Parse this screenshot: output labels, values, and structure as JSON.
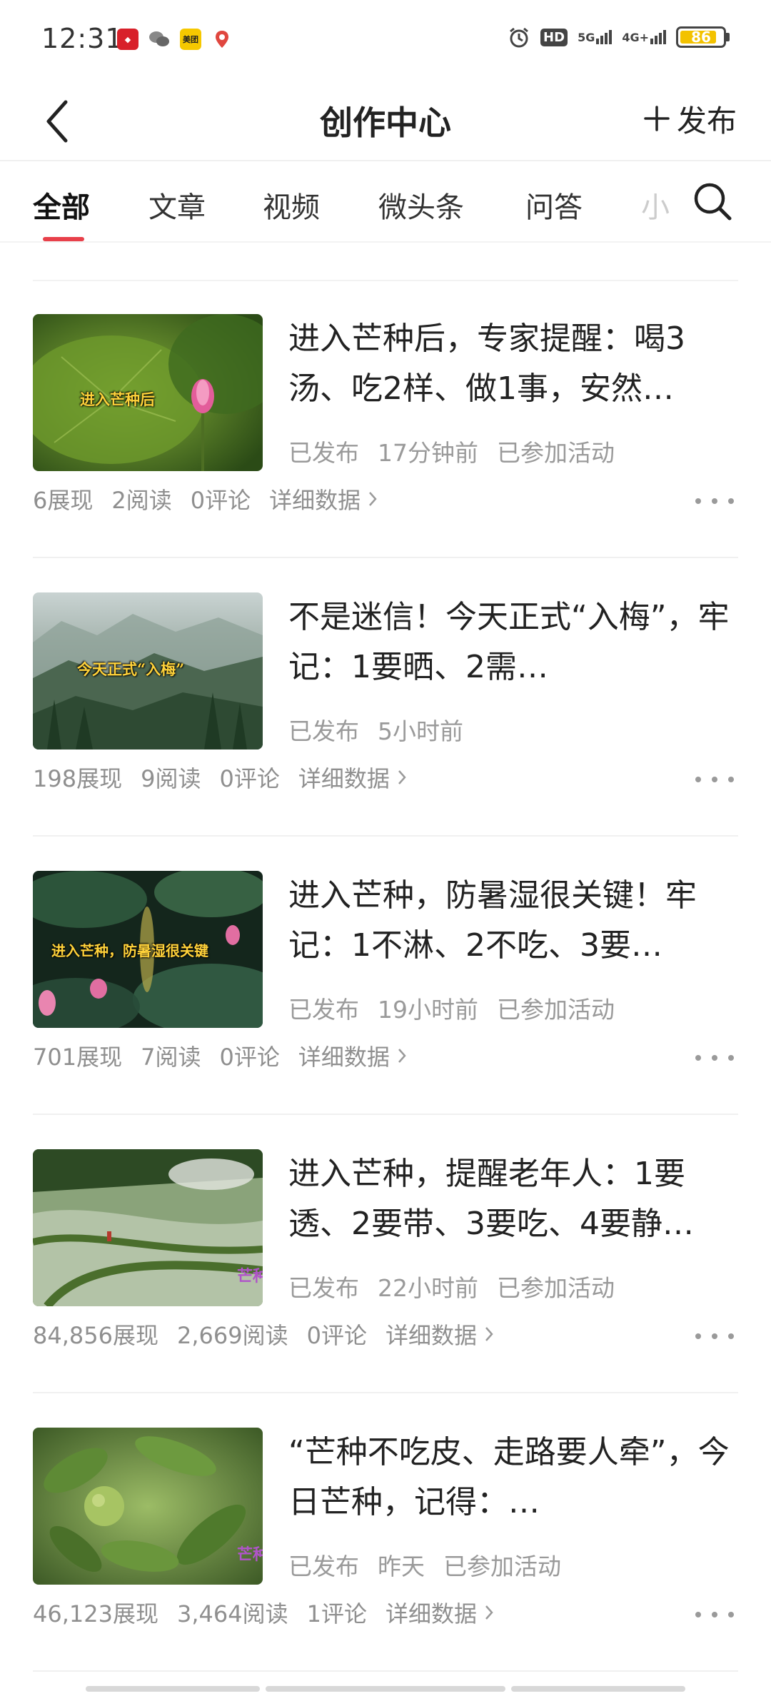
{
  "status_bar": {
    "time": "12:31",
    "meituan_label": "美团",
    "hd_label": "HD",
    "net5g": "5G",
    "net4g": "4G+",
    "battery": "86",
    "battery_level": 0.86,
    "accent_battery": "#f3c200"
  },
  "header": {
    "title": "创作中心",
    "publish_label": "发布",
    "back_icon": "chevron-left-icon",
    "publish_icon": "plus-icon"
  },
  "tabs": {
    "items": [
      {
        "label": "全部",
        "active": true
      },
      {
        "label": "文章",
        "active": false
      },
      {
        "label": "视频",
        "active": false
      },
      {
        "label": "微头条",
        "active": false
      },
      {
        "label": "问答",
        "active": false
      }
    ],
    "partial_label": "小",
    "search_icon": "search-icon",
    "underline_color": "#e8404a"
  },
  "articles": [
    {
      "title": "进入芒种后，专家提醒：喝3汤、吃2样、做1事，安然…",
      "thumb_caption": "进入芒种后",
      "status": "已发布",
      "time": "17分钟前",
      "activity": "已参加活动",
      "impressions": "6展现",
      "reads": "2阅读",
      "comments": "0评论",
      "detail_label": "详细数据"
    },
    {
      "title": "不是迷信！今天正式“入梅”，牢记：1要晒、2需…",
      "thumb_caption": "今天正式“入梅”",
      "status": "已发布",
      "time": "5小时前",
      "activity": "",
      "impressions": "198展现",
      "reads": "9阅读",
      "comments": "0评论",
      "detail_label": "详细数据"
    },
    {
      "title": "进入芒种，防暑湿很关键！牢记：1不淋、2不吃、3要…",
      "thumb_caption": "进入芒种，防暑湿很关键",
      "status": "已发布",
      "time": "19小时前",
      "activity": "已参加活动",
      "impressions": "701展现",
      "reads": "7阅读",
      "comments": "0评论",
      "detail_label": "详细数据"
    },
    {
      "title": "进入芒种，提醒老年人：1要透、2要带、3要吃、4要静…",
      "thumb_caption": "芒种",
      "status": "已发布",
      "time": "22小时前",
      "activity": "已参加活动",
      "impressions": "84,856展现",
      "reads": "2,669阅读",
      "comments": "0评论",
      "detail_label": "详细数据"
    },
    {
      "title": "“芒种不吃皮、走路要人牵”，今日芒种，记得：…",
      "thumb_caption": "芒种",
      "status": "已发布",
      "time": "昨天",
      "activity": "已参加活动",
      "impressions": "46,123展现",
      "reads": "3,464阅读",
      "comments": "1评论",
      "detail_label": "详细数据"
    }
  ]
}
